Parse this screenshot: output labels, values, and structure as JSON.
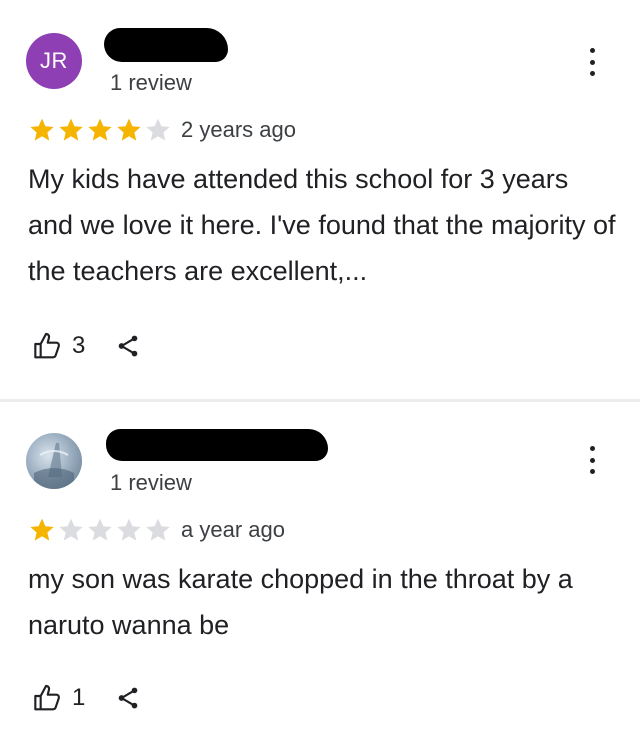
{
  "reviews": [
    {
      "avatar_initials": "JR",
      "review_count": "1 review",
      "rating": 4,
      "date": "2 years ago",
      "text": "My kids have attended this school for 3 years and we love it here.  I've found that the majority of the teachers are excellent,...",
      "likes": "3"
    },
    {
      "avatar_initials": "",
      "review_count": "1 review",
      "rating": 1,
      "date": "a year ago",
      "text": "my son was karate chopped in the throat by a naruto wanna be",
      "likes": "1"
    }
  ],
  "colors": {
    "avatar_jr": "#8e3fb3",
    "star_filled": "#f4b400",
    "star_empty": "#dadce0",
    "text": "#202124"
  },
  "icons": {
    "like": "thumb-up-outline-icon",
    "share": "share-icon",
    "more": "more-vert-icon"
  }
}
